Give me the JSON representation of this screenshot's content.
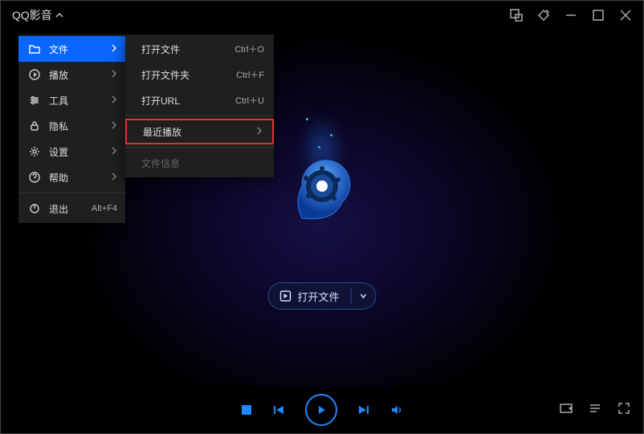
{
  "app_title": "QQ影音",
  "menu": {
    "items": [
      {
        "label": "文件",
        "icon": "folder"
      },
      {
        "label": "播放",
        "icon": "play-circle"
      },
      {
        "label": "工具",
        "icon": "tools"
      },
      {
        "label": "隐私",
        "icon": "lock"
      },
      {
        "label": "设置",
        "icon": "gear"
      },
      {
        "label": "帮助",
        "icon": "help"
      }
    ],
    "exit": {
      "label": "退出",
      "shortcut": "Alt+F4",
      "icon": "power"
    }
  },
  "submenu": {
    "items": [
      {
        "label": "打开文件",
        "shortcut": "Ctrl＋O"
      },
      {
        "label": "打开文件夹",
        "shortcut": "Ctrl＋F"
      },
      {
        "label": "打开URL",
        "shortcut": "Ctrl＋U"
      },
      {
        "label": "最近播放",
        "has_submenu": true
      },
      {
        "label": "文件信息",
        "disabled": true
      }
    ]
  },
  "stage": {
    "open_button_label": "打开文件"
  }
}
